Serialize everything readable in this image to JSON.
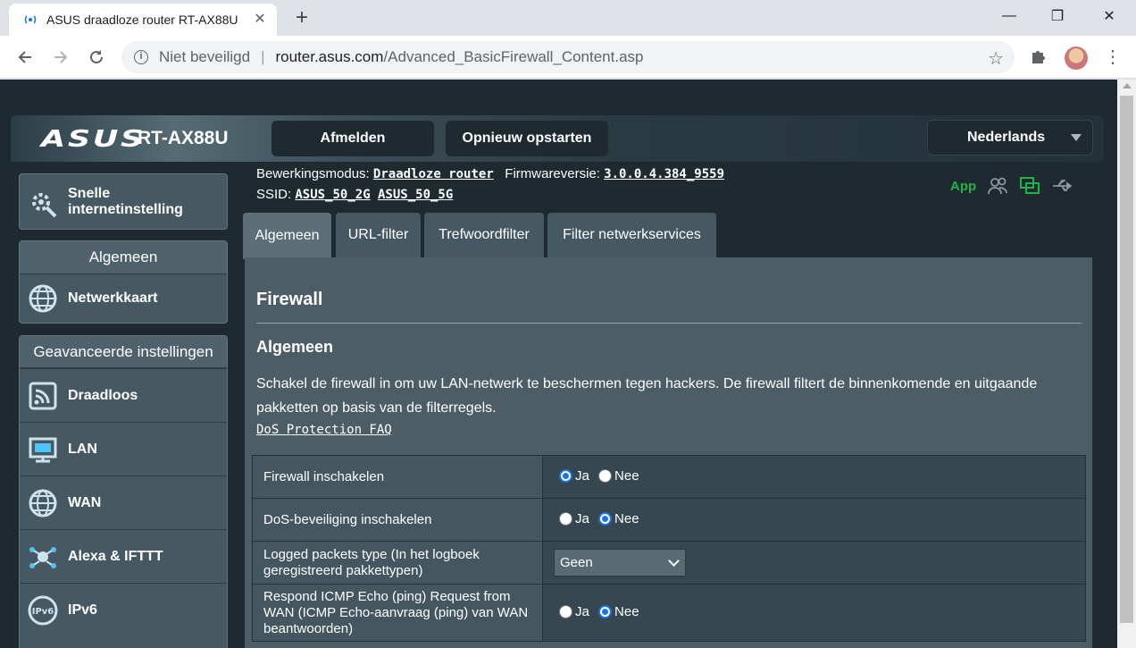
{
  "browser": {
    "tab_title": "ASUS draadloze router RT-AX88U",
    "security_label": "Niet beveiligd",
    "url_domain": "router.asus.com",
    "url_path": "/Advanced_BasicFirewall_Content.asp"
  },
  "header": {
    "brand": "ASUS",
    "model": "RT-AX88U",
    "logout_label": "Afmelden",
    "reboot_label": "Opnieuw opstarten",
    "language": "Nederlands"
  },
  "info": {
    "mode_label": "Bewerkingsmodus:",
    "mode_value": "Draadloze router",
    "firmware_label": "Firmwareversie:",
    "firmware_value": "3.0.0.4.384_9559",
    "ssid_label": "SSID:",
    "ssid_1": "ASUS_50_2G",
    "ssid_2": "ASUS_50_5G",
    "app_label": "App"
  },
  "sidebar": {
    "quick_setup": "Snelle internetinstelling",
    "general_header": "Algemeen",
    "general_items": [
      {
        "label": "Netwerkkaart",
        "icon": "globe-map-icon"
      }
    ],
    "advanced_header": "Geavanceerde instellingen",
    "advanced_items": [
      {
        "label": "Draadloos",
        "icon": "wireless-icon"
      },
      {
        "label": "LAN",
        "icon": "lan-icon"
      },
      {
        "label": "WAN",
        "icon": "wan-globe-icon"
      },
      {
        "label": "Alexa & IFTTT",
        "icon": "alexa-icon"
      },
      {
        "label": "IPv6",
        "icon": "ipv6-icon"
      }
    ]
  },
  "tabs": [
    {
      "label": "Algemeen",
      "active": true
    },
    {
      "label": "URL-filter",
      "active": false
    },
    {
      "label": "Trefwoordfilter",
      "active": false
    },
    {
      "label": "Filter netwerkservices",
      "active": false
    }
  ],
  "content": {
    "title": "Firewall",
    "subtitle": "Algemeen",
    "description": "Schakel de firewall in om uw LAN-netwerk te beschermen tegen hackers. De firewall filtert de binnenkomende en uitgaande pakketten op basis van de filterregels.",
    "faq_link": "DoS Protection FAQ",
    "yes_label": "Ja",
    "no_label": "Nee",
    "rows": [
      {
        "label": "Firewall inschakelen",
        "value": "Ja"
      },
      {
        "label": "DoS-beveiliging inschakelen",
        "value": "Nee"
      },
      {
        "label": "Logged packets type (In het logboek geregistreerd pakkettypen)",
        "value": "Geen"
      },
      {
        "label": "Respond ICMP Echo (ping) Request from WAN (ICMP Echo-aanvraag (ping) van WAN beantwoorden)",
        "value": "Nee"
      }
    ]
  },
  "colors": {
    "page_bg": "#1f2a30",
    "panel": "#4c5d66",
    "accent": "#1a73e8",
    "app_green": "#22b14c"
  }
}
